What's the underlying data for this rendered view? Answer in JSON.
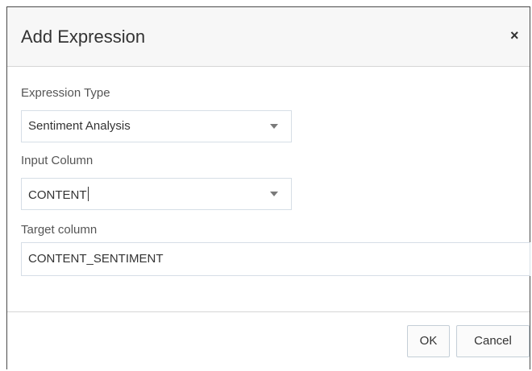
{
  "dialog": {
    "title": "Add Expression",
    "close_icon": "close-icon",
    "close_glyph": "×"
  },
  "form": {
    "expression_type": {
      "label": "Expression Type",
      "value": "Sentiment Analysis"
    },
    "input_column": {
      "label": "Input Column",
      "value": "CONTENT"
    },
    "target_column": {
      "label": "Target column",
      "value": "CONTENT_SENTIMENT"
    }
  },
  "footer": {
    "ok_label": "OK",
    "cancel_label": "Cancel"
  }
}
